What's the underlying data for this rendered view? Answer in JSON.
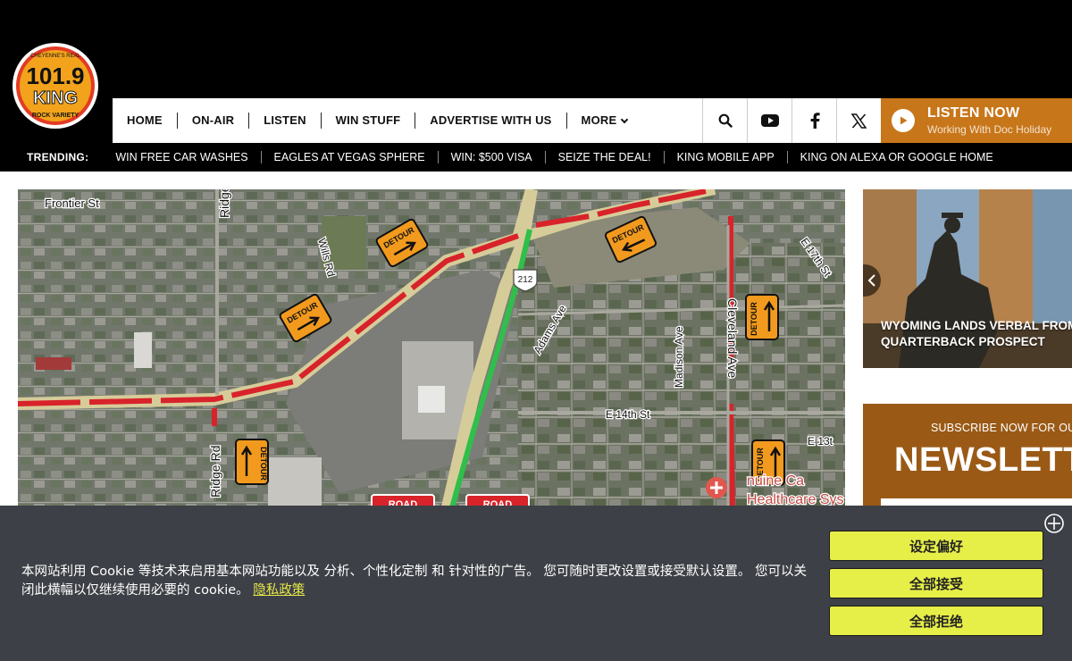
{
  "brand": {
    "logo_number": "101.9",
    "logo_word": "KING",
    "logo_top_text": "CHEYENNE'S REAL",
    "logo_bottom_text": "ROCK VARIETY"
  },
  "nav": {
    "items": [
      "HOME",
      "ON-AIR",
      "LISTEN",
      "WIN STUFF",
      "ADVERTISE WITH US",
      "MORE"
    ],
    "icons": [
      "search-icon",
      "youtube-icon",
      "facebook-icon",
      "x-twitter-icon"
    ]
  },
  "listen": {
    "title": "LISTEN NOW",
    "subtitle": "Working With Doc Holiday"
  },
  "trending": {
    "label": "TRENDING:",
    "items": [
      "WIN FREE CAR WASHES",
      "EAGLES AT VEGAS SPHERE",
      "WIN: $500 VISA",
      "SEIZE THE DEAL!",
      "KING MOBILE APP",
      "KING ON ALEXA OR GOOGLE HOME"
    ]
  },
  "map": {
    "streets": {
      "frontier": "Frontier St",
      "ridge_top": "Ridge",
      "ridge_bottom": "Ridge Rd",
      "wills": "Wills Rd",
      "adams": "Adams Ave",
      "madison": "Madison Ave",
      "cleveland": "Cleveland Ave",
      "e14": "E 14th St",
      "e13": "E 13t",
      "e17": "E 17th St",
      "highway": "212"
    },
    "detour_label": "DETOUR",
    "road_label": "ROAD",
    "healthcare_1": "nuine Ca",
    "healthcare_2": "Healthcare Sys"
  },
  "story": {
    "title_line1": "WYOMING LANDS VERBAL FROM 3-",
    "title_line2": "QUARTERBACK PROSPECT"
  },
  "newsletter": {
    "subtitle": "SUBSCRIBE NOW FOR OUR",
    "title": "NEWSLETTE"
  },
  "cookie": {
    "text": "本网站利用 Cookie 等技术来启用基本网站功能以及 分析、个性化定制 和 针对性的广告。 您可随时更改设置或接受默认设置。 您可以关闭此横幅以仅继续使用必要的 cookie。",
    "link": "隐私政策",
    "buttons": {
      "preferences": "设定偏好",
      "accept_all": "全部接受",
      "reject_all": "全部拒绝"
    }
  },
  "colors": {
    "brand_orange": "#c8761a",
    "detour_red": "#d8232a",
    "route_green": "#2fbf4a",
    "cookie_button": "#e6ee48",
    "cookie_bg": "#3d4046"
  }
}
